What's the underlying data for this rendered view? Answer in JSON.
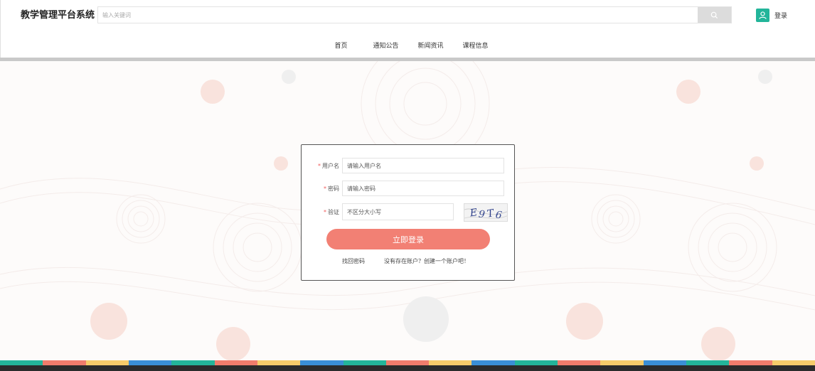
{
  "header": {
    "app_title": "教学管理平台系统",
    "search": {
      "placeholder": "输入关键词"
    },
    "login_label": "登录"
  },
  "nav": {
    "items": [
      {
        "label": "首页",
        "color": "#23b59a"
      },
      {
        "label": "通知公告",
        "color": "#f07c6c"
      },
      {
        "label": "新闻资讯",
        "color": "#f6cc6a"
      },
      {
        "label": "课程信息",
        "color": "#3a8fd6"
      }
    ]
  },
  "login_form": {
    "username": {
      "label": "用户名",
      "placeholder": "请输入用户名"
    },
    "password": {
      "label": "密码",
      "placeholder": "请输入密码"
    },
    "captcha": {
      "label": "验证",
      "placeholder": "不区分大小写",
      "image_text": "E9T6"
    },
    "submit_label": "立即登录",
    "forgot_link": "找回密码",
    "register_link": "没有存在账户？创建一个账户吧！"
  },
  "colors": {
    "accent": "#f28074",
    "brand_green": "#23b59a",
    "strip": [
      "#23b59a",
      "#f07c6c",
      "#f6cc6a",
      "#3a8fd6"
    ]
  }
}
